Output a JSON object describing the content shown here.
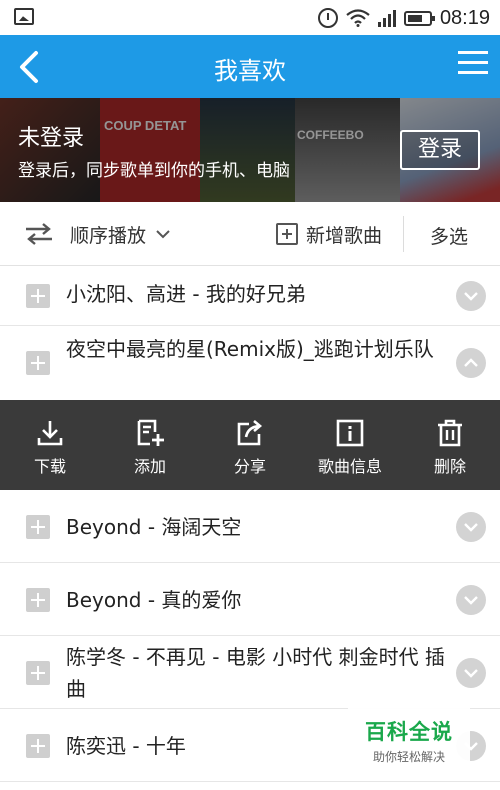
{
  "status_bar": {
    "time": "08:19",
    "icons": [
      "image-icon",
      "alarm-icon",
      "wifi-icon",
      "signal-icon",
      "battery-icon"
    ]
  },
  "title_bar": {
    "title": "我喜欢",
    "back_icon": "chevron-left-icon",
    "menu_icon": "menu-icon",
    "background": "#1e9ae6"
  },
  "banner": {
    "title": "未登录",
    "subtitle": "登录后，同步歌单到你的手机、电脑",
    "login_button": "登录",
    "cover_texts": [
      "COUP DETAT",
      "COFFEEBO"
    ]
  },
  "toolbar": {
    "play_mode": "顺序播放",
    "add_song": "新增歌曲",
    "multi_select": "多选"
  },
  "songs": [
    {
      "title": "小沈阳、高进 - 我的好兄弟",
      "expanded": false
    },
    {
      "title": "夜空中最亮的星(Remix版)_逃跑计划乐队",
      "expanded": true
    },
    {
      "title": "Beyond - 海阔天空",
      "expanded": false
    },
    {
      "title": "Beyond - 真的爱你",
      "expanded": false
    },
    {
      "title": "陈学冬 - 不再见 - 电影 小时代 刺金时代 插曲",
      "expanded": false
    },
    {
      "title": "陈奕迅 - 十年",
      "expanded": false
    }
  ],
  "song_actions": [
    {
      "label": "下载",
      "icon": "download-icon"
    },
    {
      "label": "添加",
      "icon": "add-to-list-icon"
    },
    {
      "label": "分享",
      "icon": "share-icon"
    },
    {
      "label": "歌曲信息",
      "icon": "info-icon"
    },
    {
      "label": "删除",
      "icon": "trash-icon"
    }
  ],
  "watermark": {
    "title": "百科全说",
    "subtitle": "助你轻松解决"
  }
}
